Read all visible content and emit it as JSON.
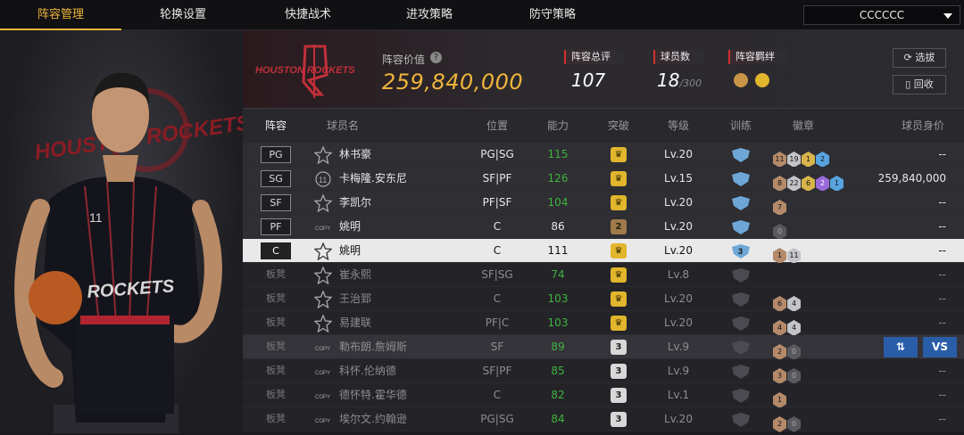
{
  "tabs": [
    {
      "label": "阵容管理",
      "active": true
    },
    {
      "label": "轮换设置"
    },
    {
      "label": "快捷战术"
    },
    {
      "label": "进攻策略"
    },
    {
      "label": "防守策略"
    }
  ],
  "team_select": "CCCCCC",
  "banner": {
    "logo_text": "HOUSTON ROCKETS",
    "value_label": "阵容价值",
    "value": "259,840,000",
    "stats": [
      {
        "label": "阵容总评",
        "value": "107"
      },
      {
        "label": "球员数",
        "value": "18",
        "sub": "/300"
      },
      {
        "label": "阵容羁绊"
      }
    ],
    "buttons": {
      "select": "选拔",
      "recycle": "回收"
    }
  },
  "player_art": {
    "wall_text": "HOUSTON ROCKETS",
    "jersey_text": "ROCKETS",
    "jersey_number": "11"
  },
  "headers": {
    "lineup": "阵容",
    "name": "球员名",
    "position": "位置",
    "ability": "能力",
    "breakthrough": "突破",
    "level": "等级",
    "training": "训练",
    "badges": "徽章",
    "value": "球员身价"
  },
  "rows": [
    {
      "slot": "PG",
      "type": "starter",
      "emblem": "star",
      "name": "林书豪",
      "position": "PG|SG",
      "ability": "115",
      "green": true,
      "brk": "crown",
      "brk_style": "gold",
      "level": "Lv.20",
      "train": "",
      "train_style": "blue",
      "badges": [
        {
          "t": "11",
          "c": "br"
        },
        {
          "t": "19",
          "c": "sv"
        },
        {
          "t": "1",
          "c": "gd"
        },
        {
          "t": "2",
          "c": "bl"
        }
      ],
      "price": "--"
    },
    {
      "slot": "SG",
      "type": "starter",
      "emblem": "11",
      "name": "卡梅隆.安东尼",
      "position": "SF|PF",
      "ability": "126",
      "green": true,
      "brk": "crown",
      "brk_style": "gold",
      "level": "Lv.15",
      "train": "",
      "train_style": "blue",
      "badges": [
        {
          "t": "8",
          "c": "br"
        },
        {
          "t": "22",
          "c": "sv"
        },
        {
          "t": "6",
          "c": "gd"
        },
        {
          "t": "2",
          "c": "pu"
        },
        {
          "t": "1",
          "c": "bl"
        }
      ],
      "price": "259,840,000"
    },
    {
      "slot": "SF",
      "type": "starter",
      "emblem": "star",
      "name": "李凯尔",
      "position": "PF|SF",
      "ability": "104",
      "green": true,
      "brk": "crown",
      "brk_style": "gold",
      "level": "Lv.20",
      "train": "",
      "train_style": "blue",
      "badges": [
        {
          "t": "7",
          "c": "br"
        }
      ],
      "price": "--"
    },
    {
      "slot": "PF",
      "type": "starter",
      "emblem": "copy",
      "name": "姚明",
      "position": "C",
      "ability": "86",
      "green": false,
      "brk": "2",
      "brk_style": "bronze",
      "level": "Lv.20",
      "train": "",
      "train_style": "blue",
      "badges": [
        {
          "t": "0",
          "c": "dk"
        }
      ],
      "price": "--"
    },
    {
      "slot": "C",
      "type": "selected",
      "emblem": "bigstar",
      "name": "姚明",
      "position": "C",
      "ability": "111",
      "green": true,
      "brk": "crown",
      "brk_style": "gold",
      "level": "Lv.20",
      "train": "3",
      "train_style": "blue",
      "badges": [
        {
          "t": "1",
          "c": "br"
        },
        {
          "t": "11",
          "c": "sv"
        }
      ],
      "price": "--"
    },
    {
      "slot": "板凳",
      "type": "bench",
      "emblem": "star",
      "name": "崔永熙",
      "position": "SF|SG",
      "ability": "74",
      "green": true,
      "brk": "crown",
      "brk_style": "gold",
      "level": "Lv.8",
      "train": "",
      "train_style": "dark",
      "badges": [],
      "price": "--"
    },
    {
      "slot": "板凳",
      "type": "bench",
      "emblem": "star",
      "name": "王治郅",
      "position": "C",
      "ability": "103",
      "green": true,
      "brk": "crown",
      "brk_style": "gold",
      "level": "Lv.20",
      "train": "",
      "train_style": "dark",
      "badges": [
        {
          "t": "6",
          "c": "br"
        },
        {
          "t": "4",
          "c": "sv"
        }
      ],
      "price": "--"
    },
    {
      "slot": "板凳",
      "type": "bench",
      "emblem": "star",
      "name": "易建联",
      "position": "PF|C",
      "ability": "103",
      "green": true,
      "brk": "crown",
      "brk_style": "gold",
      "level": "Lv.20",
      "train": "",
      "train_style": "dark",
      "badges": [
        {
          "t": "4",
          "c": "br"
        },
        {
          "t": "4",
          "c": "sv"
        }
      ],
      "price": "--"
    },
    {
      "slot": "板凳",
      "type": "bench hl",
      "emblem": "copy",
      "name": "勒布朗.詹姆斯",
      "position": "SF",
      "ability": "89",
      "green": true,
      "brk": "3",
      "brk_style": "grey",
      "level": "Lv.9",
      "train": "",
      "train_style": "dark",
      "badges": [
        {
          "t": "2",
          "c": "br"
        },
        {
          "t": "0",
          "c": "dk"
        }
      ],
      "price": "",
      "actions": {
        "swap": "⇅",
        "vs": "VS"
      }
    },
    {
      "slot": "板凳",
      "type": "bench",
      "emblem": "copy",
      "name": "科怀.伦纳德",
      "position": "SF|PF",
      "ability": "85",
      "green": true,
      "brk": "3",
      "brk_style": "grey",
      "level": "Lv.9",
      "train": "",
      "train_style": "dark",
      "badges": [
        {
          "t": "3",
          "c": "br"
        },
        {
          "t": "0",
          "c": "dk"
        }
      ],
      "price": "--"
    },
    {
      "slot": "板凳",
      "type": "bench",
      "emblem": "copy",
      "name": "德怀特.霍华德",
      "position": "C",
      "ability": "82",
      "green": true,
      "brk": "3",
      "brk_style": "grey",
      "level": "Lv.1",
      "train": "",
      "train_style": "dark",
      "badges": [
        {
          "t": "1",
          "c": "br"
        }
      ],
      "price": "--"
    },
    {
      "slot": "板凳",
      "type": "bench",
      "emblem": "copy",
      "name": "埃尔文.约翰逊",
      "position": "PG|SG",
      "ability": "84",
      "green": true,
      "brk": "3",
      "brk_style": "grey",
      "level": "Lv.20",
      "train": "",
      "train_style": "dark",
      "badges": [
        {
          "t": "2",
          "c": "br"
        },
        {
          "t": "0",
          "c": "dk"
        }
      ],
      "price": "--"
    }
  ]
}
